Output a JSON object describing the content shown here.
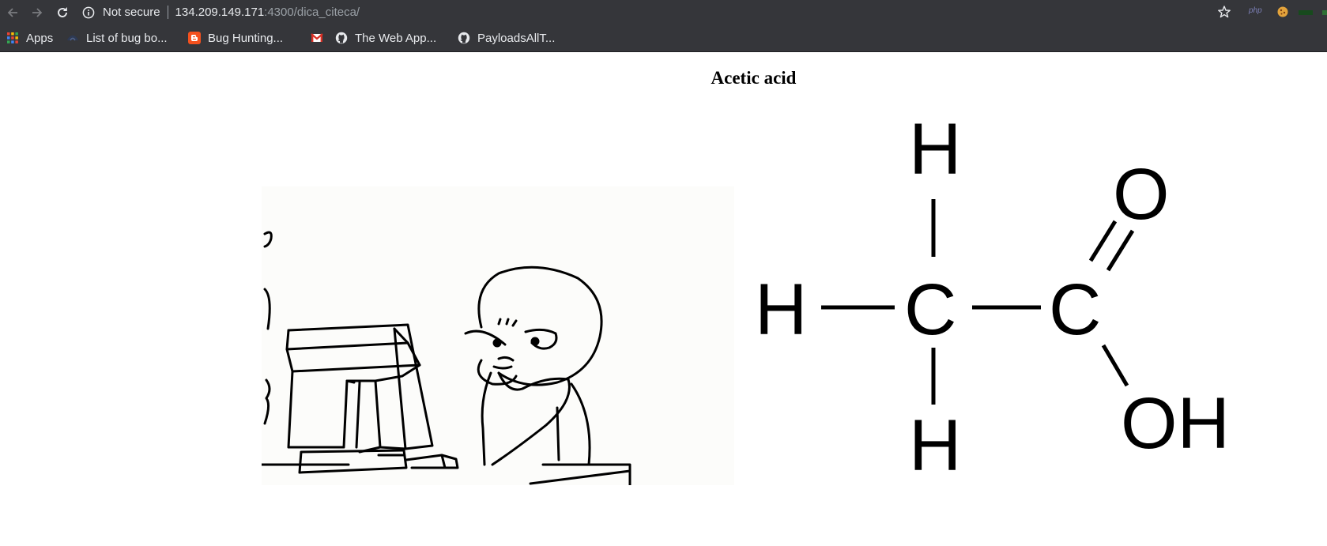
{
  "browser": {
    "security_label": "Not secure",
    "url_host": "134.209.149.171",
    "url_rest": ":4300/dica_citeca/",
    "extension_php_label": "php"
  },
  "bookmarks": [
    {
      "label": "Apps",
      "icon": "apps-grid-icon"
    },
    {
      "label": "List of bug bo...",
      "icon": "bugcrowd-icon"
    },
    {
      "label": "Bug Hunting...",
      "icon": "blogger-icon"
    },
    {
      "label": "",
      "icon": "gmail-icon"
    },
    {
      "label": "The Web App...",
      "icon": "github-icon"
    },
    {
      "label": "PayloadsAllT...",
      "icon": "github-icon"
    }
  ],
  "page": {
    "title": "Acetic acid"
  },
  "molecule": {
    "atoms": {
      "h_left": "H",
      "h_top": "H",
      "h_bottom": "H",
      "c_methyl": "C",
      "c_carboxyl": "C",
      "o_double": "O",
      "oh_group": "OH"
    }
  },
  "colors": {
    "chrome_bg": "#35363a",
    "chrome_text": "#e8eaed",
    "chrome_dim": "#9aa0a6",
    "page_bg": "#ffffff"
  }
}
